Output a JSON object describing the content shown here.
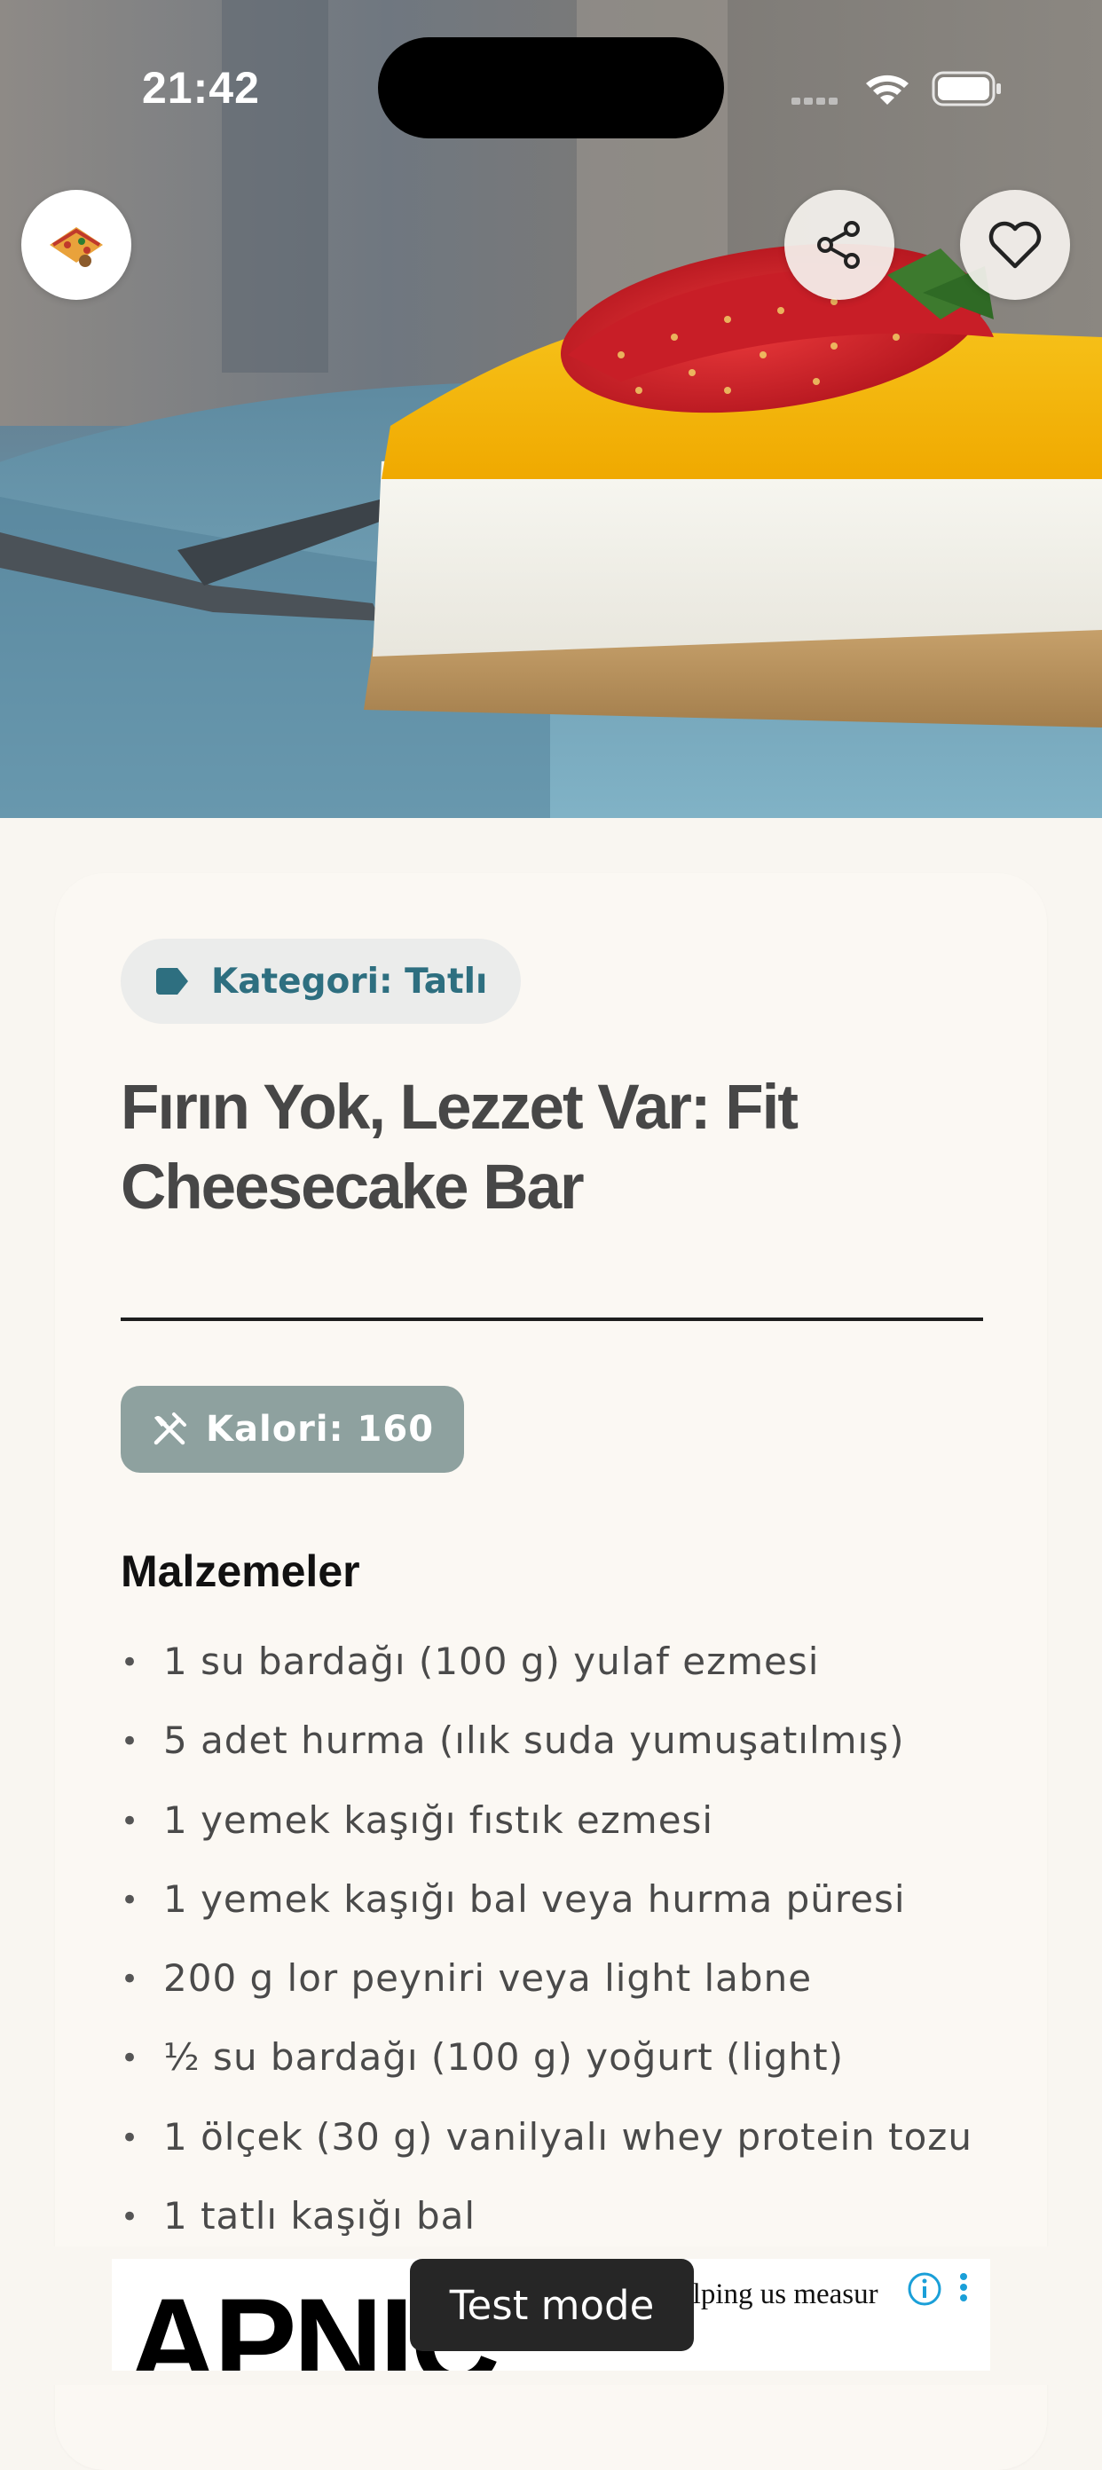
{
  "status_bar": {
    "time": "21:42"
  },
  "hero": {
    "icons": [
      "logo-icon",
      "share-icon",
      "heart-icon"
    ]
  },
  "recipe": {
    "category_label": "Kategori: Tatlı",
    "title": "Fırın Yok, Lezzet Var: Fit Cheesecake Bar",
    "calories_label": "Kalori: 160",
    "ingredients_heading": "Malzemeler",
    "ingredients": [
      "1 su bardağı (100 g) yulaf ezmesi",
      "5 adet hurma (ılık suda yumuşatılmış)",
      "1 yemek kaşığı fıstık ezmesi",
      "1 yemek kaşığı bal veya hurma püresi",
      "200 g lor peyniri veya light labne",
      "½ su bardağı (100 g) yoğurt (light)",
      "1 ölçek (30 g) vanilyalı whey protein tozu",
      "1 tatlı kaşığı bal"
    ]
  },
  "ad": {
    "brand": "APNIC",
    "text": "elping us measur",
    "toast": "Test mode"
  },
  "colors": {
    "category_text": "#2e6f80",
    "calorie_chip": "#8ea19f",
    "background": "#f9f6f1"
  }
}
